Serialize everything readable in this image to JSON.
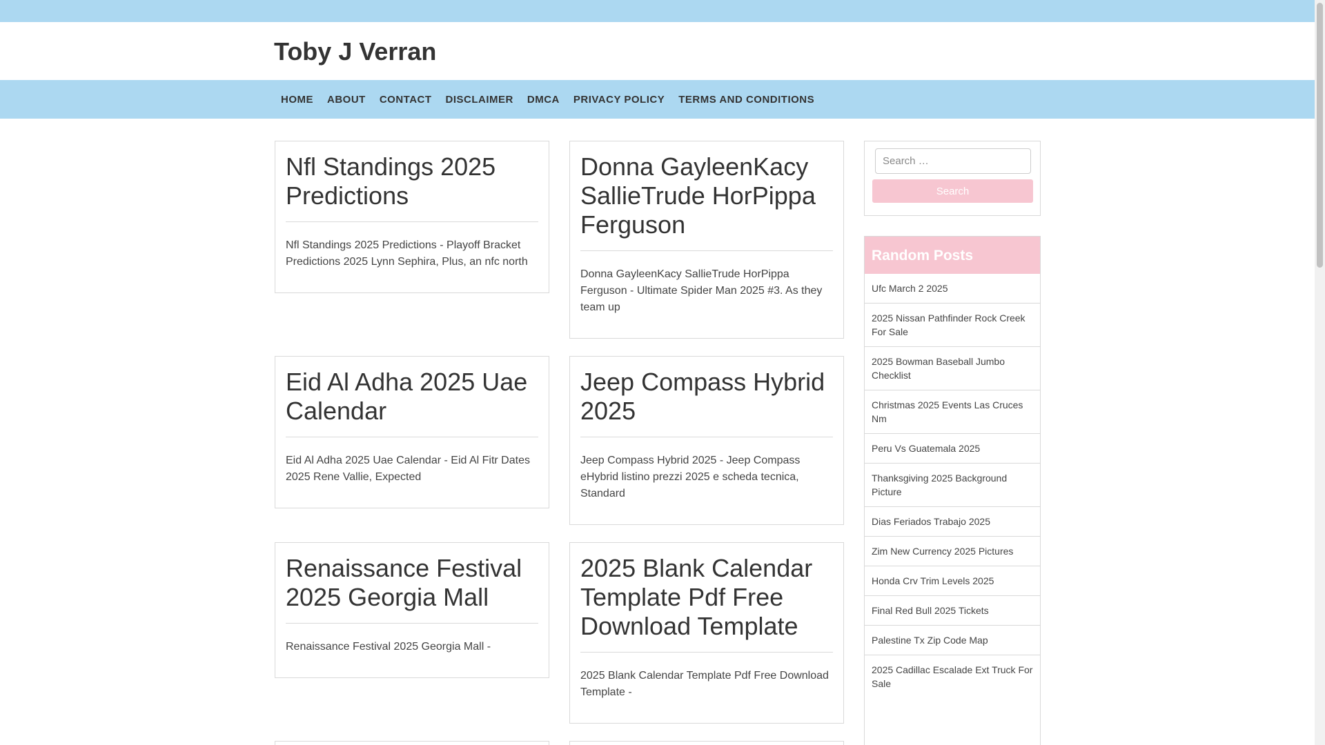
{
  "site": {
    "title": "Toby J Verran"
  },
  "nav": [
    {
      "label": "HOME"
    },
    {
      "label": "ABOUT"
    },
    {
      "label": "CONTACT"
    },
    {
      "label": "DISCLAIMER"
    },
    {
      "label": "DMCA"
    },
    {
      "label": "PRIVACY POLICY"
    },
    {
      "label": "TERMS AND CONDITIONS"
    }
  ],
  "posts": [
    {
      "title": "Nfl Standings 2025 Predictions",
      "excerpt": "Nfl Standings 2025 Predictions - Playoff Bracket Predictions 2025 Lynn Sephira, Plus, an nfc north"
    },
    {
      "title": "Donna GayleenKacy SallieTrude HorPippa Ferguson",
      "excerpt": "Donna GayleenKacy SallieTrude HorPippa Ferguson - Ultimate Spider Man 2025 #3. As they team up"
    },
    {
      "title": "Eid Al Adha 2025 Uae Calendar",
      "excerpt": "Eid Al Adha 2025 Uae Calendar - Eid Al Fitr Dates 2025 Rene Vallie, Expected"
    },
    {
      "title": "Jeep Compass Hybrid 2025",
      "excerpt": "Jeep Compass Hybrid 2025 - Jeep Compass eHybrid listino prezzi 2025 e scheda tecnica, Standard"
    },
    {
      "title": "Renaissance Festival 2025 Georgia Mall",
      "excerpt": "Renaissance Festival 2025 Georgia Mall -"
    },
    {
      "title": "2025 Blank Calendar Template Pdf Free Download Template",
      "excerpt": "2025 Blank Calendar Template Pdf Free Download Template -"
    }
  ],
  "search": {
    "placeholder": "Search …",
    "button_label": "Search"
  },
  "random_posts": {
    "heading": "Random Posts",
    "items": [
      "Ufc March 2 2025",
      "2025 Nissan Pathfinder Rock Creek For Sale",
      "2025 Bowman Baseball Jumbo Checklist",
      "Christmas 2025 Events Las Cruces Nm",
      "Peru Vs Guatemala 2025",
      "Thanksgiving 2025 Background Picture",
      "Dias Feriados Trabajo 2025",
      "Zim New Currency 2025 Pictures",
      "Honda Crv Trim Levels 2025",
      "Final Red Bull 2025 Tickets",
      "Palestine Tx Zip Code Map",
      "2025 Cadillac Escalade Ext Truck For Sale"
    ]
  },
  "colors": {
    "nav_background": "#acd8f1",
    "accent_pink": "#f7c6d1",
    "text": "#333333",
    "border": "#d9d9d9"
  }
}
